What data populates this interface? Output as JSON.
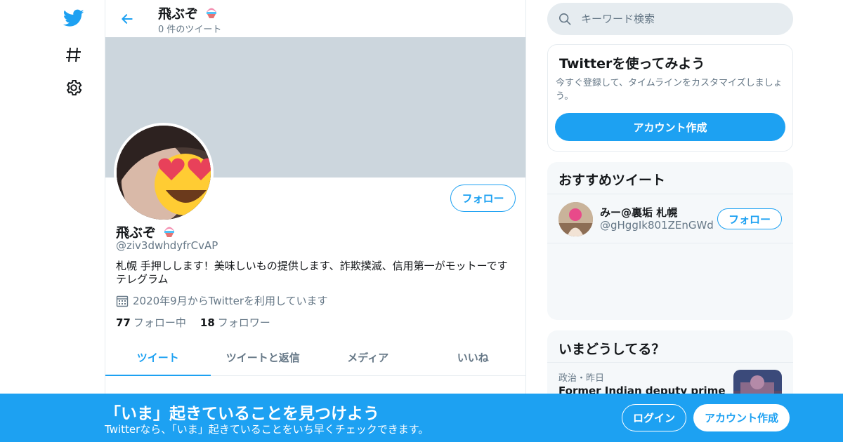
{
  "colors": {
    "accent": "#1da1f2",
    "banner": "#ccd6dd",
    "secondary_text": "#657786"
  },
  "nav": {
    "icons": [
      "twitter-bird-icon",
      "hashtag-icon",
      "gear-icon"
    ]
  },
  "header": {
    "name": "飛ぶぞ",
    "tweet_count": "0 件のツイート"
  },
  "profile": {
    "name": "飛ぶぞ",
    "handle": "@ziv3dwhdyfrCvAP",
    "bio_line1": "札幌 手押しします！美味しいもの提供します、詐欺撲滅、信用第一がモットーです",
    "bio_line2": "テレグラム",
    "joined": "2020年9月からTwitterを利用しています",
    "following_count": "77",
    "following_label": "フォロー中",
    "followers_count": "18",
    "followers_label": "フォロワー",
    "follow_button": "フォロー"
  },
  "tabs": [
    "ツイート",
    "ツイートと返信",
    "メディア",
    "いいね"
  ],
  "search": {
    "placeholder": "キーワード検索"
  },
  "signup_card": {
    "title": "Twitterを使ってみよう",
    "description": "今すぐ登録して、タイムラインをカスタマイズしましょう。",
    "button": "アカウント作成"
  },
  "recommended": {
    "title": "おすすめツイート",
    "users": [
      {
        "name": "みー@裏垢 札幌",
        "handle": "@gHggIk801ZEnGWd",
        "button": "フォロー"
      }
    ]
  },
  "trends": {
    "title": "いまどうしてる？",
    "items": [
      {
        "meta": "政治・昨日",
        "text": "Former Indian deputy prime"
      }
    ]
  },
  "bottom_bar": {
    "title": "「いま」起きていることを見つけよう",
    "subtitle": "Twitterなら、「いま」起きていることをいち早くチェックできます。",
    "login": "ログイン",
    "signup": "アカウント作成"
  }
}
